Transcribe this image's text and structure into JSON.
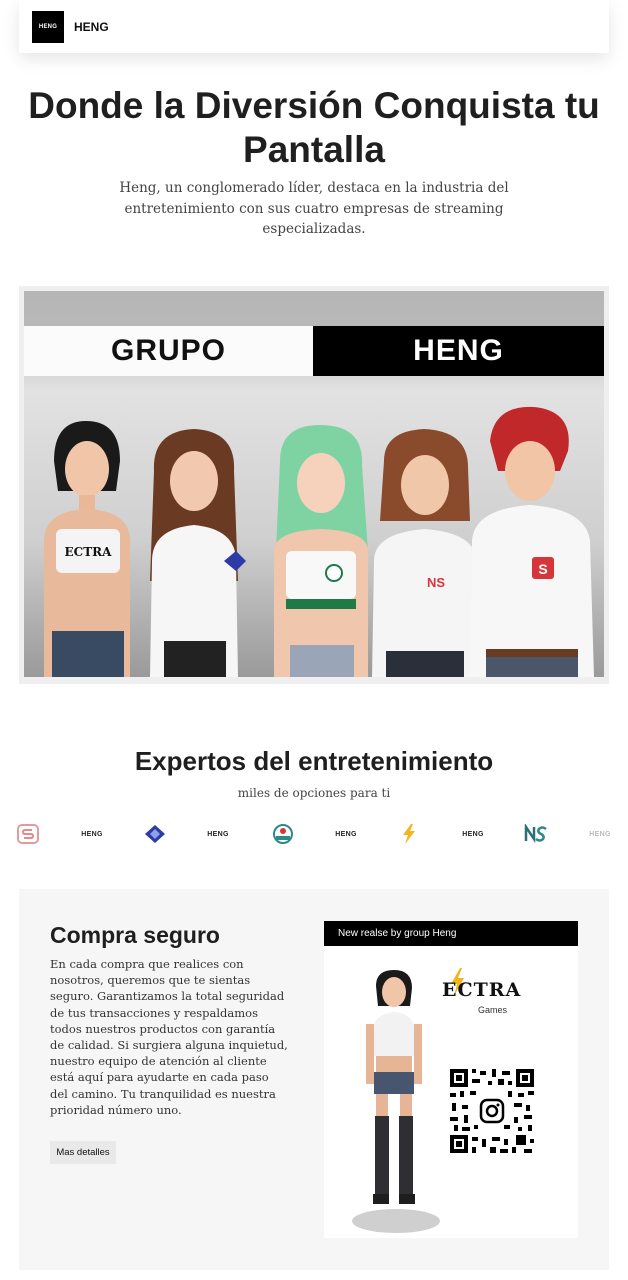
{
  "header": {
    "logo_text": "HENG",
    "brand": "HENG"
  },
  "hero": {
    "title": "Donde la Diversión Conquista tu Pantalla",
    "subtitle": "Heng, un conglomerado líder, destaca en la industria del entretenimiento con sus cuatro empresas de streaming especializadas."
  },
  "banner": {
    "left_word": "GRUPO",
    "right_word": "HENG",
    "shirt_logo_text": "ECTRA"
  },
  "experts": {
    "title": "Expertos del entretenimiento",
    "subtitle": "miles de opciones para ti",
    "logos": [
      {
        "icon": "s-brand-icon"
      },
      {
        "text": "HENG"
      },
      {
        "icon": "diamond-brand-icon"
      },
      {
        "text": "HENG"
      },
      {
        "icon": "circle-badge-brand-icon"
      },
      {
        "text": "HENG"
      },
      {
        "icon": "lightning-brand-icon"
      },
      {
        "text": "HENG"
      },
      {
        "icon": "ns-brand-icon"
      },
      {
        "text": "HENG"
      }
    ]
  },
  "secure": {
    "title": "Compra seguro",
    "body": "En cada compra que realices con nosotros, queremos que te sientas seguro. Garantizamos la total seguridad de tus transacciones y respaldamos todos nuestros productos con garantía de calidad. Si surgiera alguna inquietud, nuestro equipo de atención al cliente está aquí para ayudarte en cada paso del camino. Tu tranquilidad es nuestra prioridad número uno.",
    "button": "Mas detalles"
  },
  "promo": {
    "bar_text": "New realse by group  Heng",
    "brand": "ECTRA",
    "brand_sub": "Games"
  },
  "colors": {
    "accent": "#000000",
    "lightning": "#f2b51c",
    "red_logo": "#d6353a",
    "diamond": "#2d3aa8",
    "teal": "#2b8a8a"
  }
}
